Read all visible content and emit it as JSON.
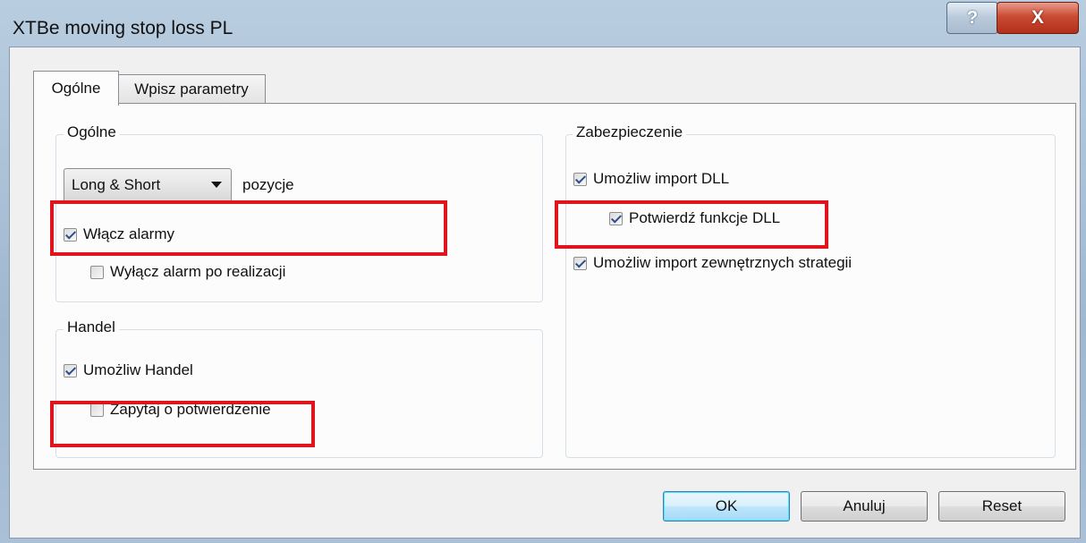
{
  "window": {
    "title": "XTBe moving stop loss PL",
    "help_glyph": "?",
    "close_glyph": "X"
  },
  "tabs": [
    {
      "label": "Ogólne",
      "active": true
    },
    {
      "label": "Wpisz parametry",
      "active": false
    }
  ],
  "general_group": {
    "label": "Ogólne",
    "position_select": {
      "value": "Long & Short"
    },
    "position_suffix": "pozycje",
    "enable_alerts": {
      "label": "Włącz alarmy",
      "checked": true
    },
    "disable_alert_after_fill": {
      "label": "Wyłącz alarm po realizacji",
      "checked": false
    }
  },
  "trade_group": {
    "label": "Handel",
    "enable_trading": {
      "label": "Umożliw Handel",
      "checked": true
    },
    "ask_confirmation": {
      "label": "Zapytaj o potwierdzenie",
      "checked": false
    }
  },
  "security_group": {
    "label": "Zabezpieczenie",
    "allow_dll_import": {
      "label": "Umożliw import DLL",
      "checked": true
    },
    "confirm_dll_calls": {
      "label": "Potwierdź funkcje DLL",
      "checked": true
    },
    "allow_external_import": {
      "label": "Umożliw import zewnętrznych strategii",
      "checked": true
    }
  },
  "buttons": {
    "ok": "OK",
    "cancel": "Anuluj",
    "reset": "Reset"
  },
  "colors": {
    "highlight": "#e0141c",
    "check": "#2b4e8a",
    "close_button": "#cb4a32",
    "title_bar": "#b9cde0"
  }
}
